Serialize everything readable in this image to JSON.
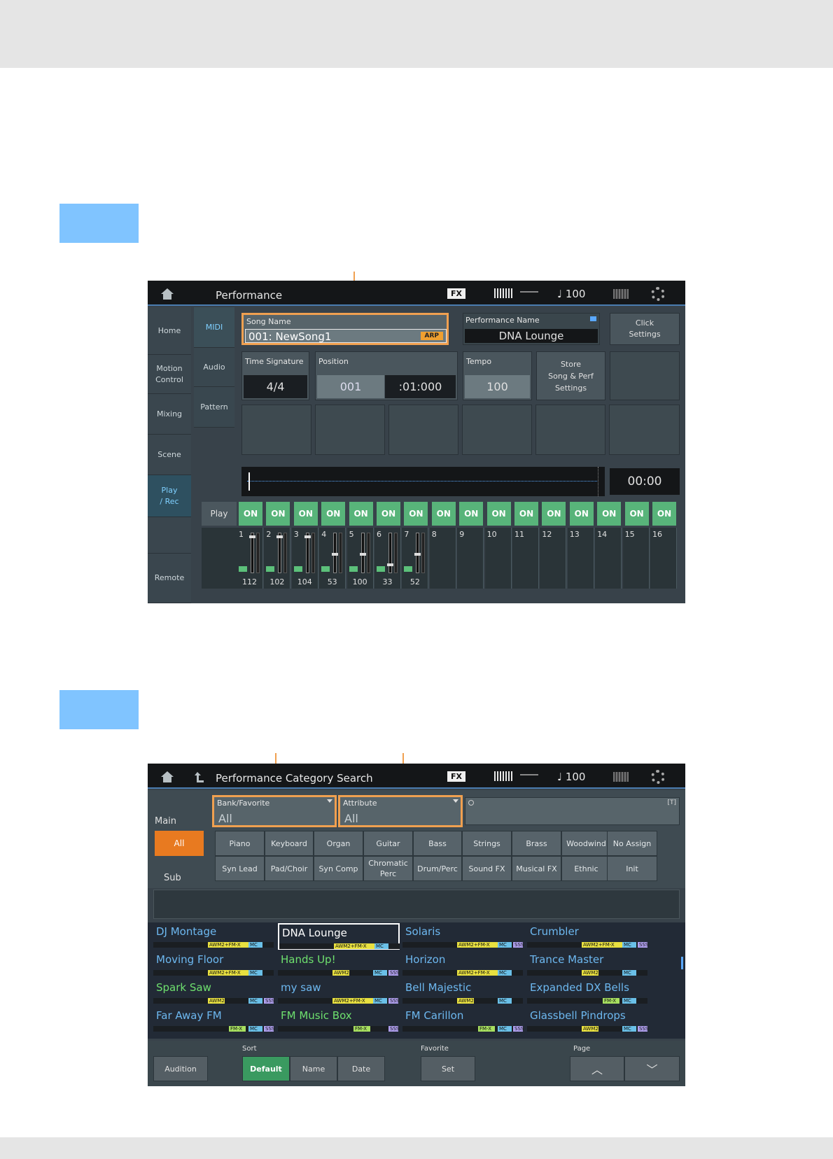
{
  "screen1": {
    "title": "Performance",
    "fx_label": "FX",
    "tempo_display": "♩ 100",
    "side_buttons": [
      "Home",
      "Motion\nControl",
      "Mixing",
      "Scene",
      "Play\n/ Rec",
      "Remote"
    ],
    "sub_buttons": [
      "MIDI",
      "Audio",
      "Pattern"
    ],
    "song_name_label": "Song Name",
    "song_name_value": "001: NewSong1",
    "arp_badge": "ARP",
    "performance_name_label": "Performance Name",
    "performance_name_value": "DNA Lounge",
    "click_settings": "Click\nSettings",
    "time_signature_label": "Time Signature",
    "time_signature_value": "4/4",
    "position_label": "Position",
    "position_measure": "001",
    "position_time": ":01:000",
    "tempo_label": "Tempo",
    "tempo_value": "100",
    "store_settings": "Store\nSong & Perf\nSettings",
    "time_readout": "00:00",
    "play_label": "Play",
    "on_label": "ON",
    "parts": [
      {
        "num": "1",
        "value": "112"
      },
      {
        "num": "2",
        "value": "102"
      },
      {
        "num": "3",
        "value": "104"
      },
      {
        "num": "4",
        "value": "53"
      },
      {
        "num": "5",
        "value": "100"
      },
      {
        "num": "6",
        "value": "33"
      },
      {
        "num": "7",
        "value": "52"
      },
      {
        "num": "8",
        "value": ""
      },
      {
        "num": "9",
        "value": ""
      },
      {
        "num": "10",
        "value": ""
      },
      {
        "num": "11",
        "value": ""
      },
      {
        "num": "12",
        "value": ""
      },
      {
        "num": "13",
        "value": ""
      },
      {
        "num": "14",
        "value": ""
      },
      {
        "num": "15",
        "value": ""
      },
      {
        "num": "16",
        "value": ""
      }
    ]
  },
  "screen2": {
    "title": "Performance Category Search",
    "fx_label": "FX",
    "tempo_display": "♩ 100",
    "bank_label": "Bank/Favorite",
    "bank_value": "All",
    "attribute_label": "Attribute",
    "attribute_value": "All",
    "text_badge": "[T]",
    "main_label": "Main",
    "sub_label": "Sub",
    "all_button": "All",
    "main_categories": [
      "Piano",
      "Keyboard",
      "Organ",
      "Guitar",
      "Bass",
      "Strings",
      "Brass",
      "Woodwind",
      "No Assign"
    ],
    "sub_categories": [
      "Syn Lead",
      "Pad/Choir",
      "Syn Comp",
      "Chromatic\nPerc",
      "Drum/Perc",
      "Sound FX",
      "Musical FX",
      "Ethnic",
      "Init"
    ],
    "results": [
      {
        "name": "DJ Montage",
        "tags": [
          "AWM2+FM-X",
          "MC"
        ]
      },
      {
        "name": "DNA Lounge",
        "tags": [
          "AWM2+FM-X",
          "MC"
        ]
      },
      {
        "name": "Solaris",
        "tags": [
          "AWM2+FM-X",
          "MC",
          "SSS"
        ]
      },
      {
        "name": "Crumbler",
        "tags": [
          "AWM2+FM-X",
          "MC",
          "SSS"
        ]
      },
      {
        "name": "Moving Floor",
        "tags": [
          "AWM2+FM-X",
          "MC"
        ]
      },
      {
        "name": "Hands Up!",
        "tags": [
          "AWM2",
          "MC",
          "SSS"
        ]
      },
      {
        "name": "Horizon",
        "tags": [
          "AWM2+FM-X",
          "MC"
        ]
      },
      {
        "name": "Trance Master",
        "tags": [
          "AWM2",
          "MC"
        ]
      },
      {
        "name": "Spark Saw",
        "tags": [
          "AWM2",
          "MC",
          "SSS"
        ]
      },
      {
        "name": "my saw",
        "tags": [
          "AWM2+FM-X",
          "MC",
          "SSS"
        ]
      },
      {
        "name": "Bell Majestic",
        "tags": [
          "AWM2",
          "MC"
        ]
      },
      {
        "name": "Expanded DX Bells",
        "tags": [
          "FM-X",
          "MC"
        ]
      },
      {
        "name": "Far Away FM",
        "tags": [
          "FM-X",
          "MC",
          "SSS"
        ]
      },
      {
        "name": "FM Music Box",
        "tags": [
          "FM-X",
          "SSS"
        ]
      },
      {
        "name": "FM Carillon",
        "tags": [
          "FM-X",
          "MC",
          "SSS"
        ]
      },
      {
        "name": "Glassbell Pindrops",
        "tags": [
          "AWM2",
          "MC",
          "SSS"
        ]
      }
    ],
    "audition": "Audition",
    "sort_label": "Sort",
    "sort_default": "Default",
    "sort_name": "Name",
    "sort_date": "Date",
    "favorite_label": "Favorite",
    "favorite_set": "Set",
    "page_label": "Page",
    "page_up": "︿",
    "page_down": "﹀"
  },
  "colors": {
    "callout": "#f0a050",
    "accent_blue": "#80c4ff",
    "on_green": "#58b47a",
    "all_orange": "#e87a20"
  }
}
